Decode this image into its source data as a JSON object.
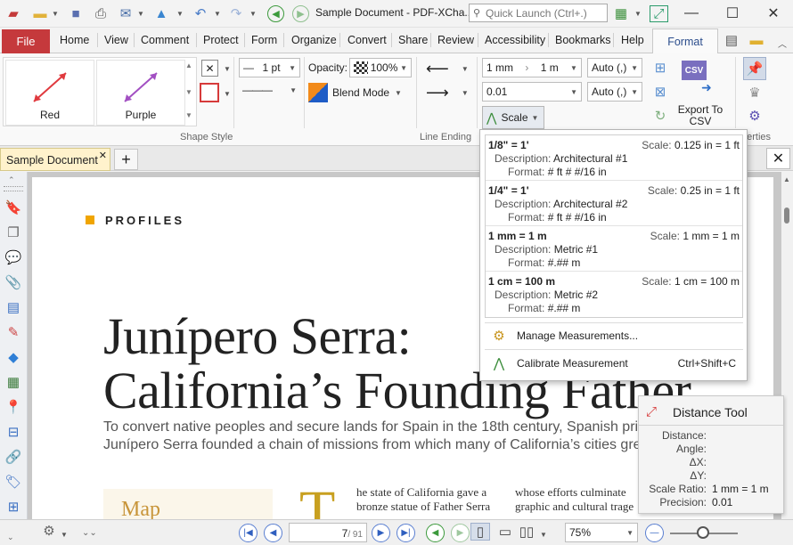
{
  "window": {
    "title": "Sample Document - PDF-XCha...",
    "quick_launch_placeholder": "Quick Launch (Ctrl+.)"
  },
  "menu": {
    "file": "File",
    "tabs": [
      "Home",
      "View",
      "Comment",
      "Protect",
      "Form",
      "Organize",
      "Convert",
      "Share",
      "Review",
      "Accessibility",
      "Bookmarks",
      "Help"
    ],
    "active": "Format"
  },
  "ribbon": {
    "shape_styles": [
      {
        "label": "Red",
        "color": "#e0393e"
      },
      {
        "label": "Purple",
        "color": "#a24fc2"
      }
    ],
    "shape_style_title": "Shape Style",
    "line_width": "1 pt",
    "opacity_label": "Opacity:",
    "opacity_value": "100%",
    "blend_mode": "Blend Mode",
    "line_ending_title": "Line Ending",
    "scale_from": "1 mm",
    "scale_to": "1 m",
    "precision": "0.01",
    "auto1": "Auto (,)",
    "auto2": "Auto (,)",
    "scale_button": "Scale",
    "export_csv": "Export To CSV",
    "csv_badge": "CSV",
    "properties_partial": "perties"
  },
  "doc_tab": {
    "label": "Sample Document"
  },
  "scale_popup": {
    "items": [
      {
        "name": "1/8\" = 1'",
        "scale_label": "Scale:",
        "scale": "0.125 in = 1 ft",
        "desc_label": "Description:",
        "desc": "Architectural #1",
        "fmt_label": "Format:",
        "fmt": "# ft # #/16 in"
      },
      {
        "name": "1/4\" = 1'",
        "scale_label": "Scale:",
        "scale": "0.25 in = 1 ft",
        "desc_label": "Description:",
        "desc": "Architectural #2",
        "fmt_label": "Format:",
        "fmt": "# ft # #/16 in"
      },
      {
        "name": "1 mm = 1 m",
        "scale_label": "Scale:",
        "scale": "1 mm = 1 m",
        "desc_label": "Description:",
        "desc": "Metric #1",
        "fmt_label": "Format:",
        "fmt": "#.## m"
      },
      {
        "name": "1 cm = 100 m",
        "scale_label": "Scale:",
        "scale": "1 cm = 100 m",
        "desc_label": "Description:",
        "desc": "Metric #2",
        "fmt_label": "Format:",
        "fmt": "#.## m"
      }
    ],
    "manage": "Manage Measurements...",
    "calibrate": "Calibrate Measurement",
    "calibrate_shortcut": "Ctrl+Shift+C"
  },
  "document": {
    "section": "PROFILES",
    "headline1": "Junípero Serra:",
    "headline2": "California’s Founding Father",
    "sub1": "To convert native peoples and secure lands for Spain in the 18th century, Spanish pries",
    "sub2": "Junípero Serra founded a chain of missions from which many of California’s cities grew",
    "map": "Map",
    "dropcap": "T",
    "col1_l1": "he state of California gave a",
    "col1_l2": "bronze statue of Father Serra",
    "col2_l1": "whose efforts culminate",
    "col2_l2": "graphic and cultural trage"
  },
  "distance_tool": {
    "title": "Distance Tool",
    "rows": [
      {
        "label": "Distance:",
        "value": ""
      },
      {
        "label": "Angle:",
        "value": ""
      },
      {
        "label": "ΔX:",
        "value": ""
      },
      {
        "label": "ΔY:",
        "value": ""
      },
      {
        "label": "Scale Ratio:",
        "value": "1 mm = 1 m"
      },
      {
        "label": "Precision:",
        "value": "0.01"
      }
    ]
  },
  "statusbar": {
    "page": "7",
    "pages": "/ 91",
    "zoom": "75%"
  },
  "colors": {
    "accent": "#2b4d8c",
    "file_tab": "#c5393c",
    "doc_tab": "#fff2cc",
    "profiles_mark": "#f0a500"
  }
}
